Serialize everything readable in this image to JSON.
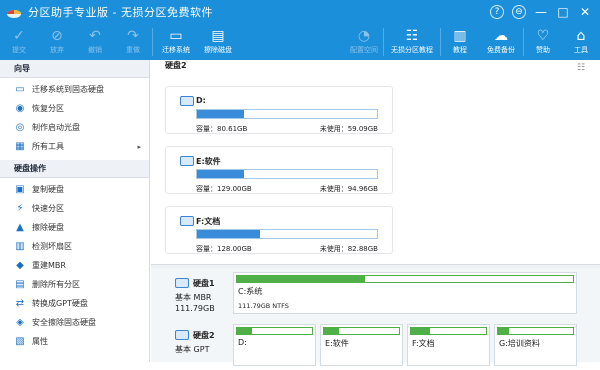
{
  "window": {
    "title": "分区助手专业版 - 无损分区免费软件",
    "controls": [
      "?",
      "⊖",
      "—",
      "□",
      "✕"
    ]
  },
  "toolbar": {
    "items": [
      {
        "name": "toolbar-submit",
        "label": "提交",
        "icon": "check-icon",
        "glyph": "✓",
        "enabled": false
      },
      {
        "name": "toolbar-discard",
        "label": "放弃",
        "icon": "discard-icon",
        "glyph": "⊘",
        "enabled": false
      },
      {
        "name": "toolbar-undo",
        "label": "撤销",
        "icon": "undo-icon",
        "glyph": "↶",
        "enabled": false
      },
      {
        "name": "toolbar-redo",
        "label": "重做",
        "icon": "redo-icon",
        "glyph": "↷",
        "enabled": false
      },
      {
        "name": "toolbar-migrate-os",
        "label": "迁移系统",
        "icon": "migrate-icon",
        "glyph": "▭",
        "enabled": true
      },
      {
        "name": "toolbar-wipe-disk",
        "label": "擦除磁盘",
        "icon": "eraser-icon",
        "glyph": "▤",
        "enabled": true
      },
      {
        "name": "toolbar-allocate-space",
        "label": "配置空间",
        "icon": "pie-icon",
        "glyph": "◔",
        "enabled": false
      },
      {
        "name": "toolbar-tutorial",
        "label": "无损分区教程",
        "icon": "tutorial-icon",
        "glyph": "☷",
        "enabled": true
      },
      {
        "name": "toolbar-tutorial-book",
        "label": "教程",
        "icon": "book-icon",
        "glyph": "▥",
        "enabled": true
      },
      {
        "name": "toolbar-free-backup",
        "label": "免费备份",
        "icon": "cloud-icon",
        "glyph": "☁",
        "enabled": true
      },
      {
        "name": "toolbar-sponsor",
        "label": "赞助",
        "icon": "heart-icon",
        "glyph": "♡",
        "enabled": true
      },
      {
        "name": "toolbar-tools",
        "label": "工具",
        "icon": "briefcase-icon",
        "glyph": "⌂",
        "enabled": true
      }
    ]
  },
  "sidebar": {
    "wizard_header": "向导",
    "wizard_items": [
      {
        "label": "迁移系统到固态硬盘",
        "icon": "migrate-icon",
        "glyph": "▭"
      },
      {
        "label": "恢复分区",
        "icon": "recover-icon",
        "glyph": "◉"
      },
      {
        "label": "制作启动光盘",
        "icon": "disc-icon",
        "glyph": "◎"
      },
      {
        "label": "所有工具",
        "icon": "tools-icon",
        "glyph": "▦",
        "arrow": "▸"
      }
    ],
    "disk_header": "硬盘操作",
    "disk_items": [
      {
        "label": "复制硬盘",
        "icon": "copy-icon",
        "glyph": "▣"
      },
      {
        "label": "快速分区",
        "icon": "lightning-icon",
        "glyph": "⚡"
      },
      {
        "label": "擦除硬盘",
        "icon": "eraser-icon",
        "glyph": "▲"
      },
      {
        "label": "检测坏扇区",
        "icon": "scan-icon",
        "glyph": "▥"
      },
      {
        "label": "重建MBR",
        "icon": "tag-icon",
        "glyph": "◆"
      },
      {
        "label": "删除所有分区",
        "icon": "delete-icon",
        "glyph": "▤"
      },
      {
        "label": "转换成GPT硬盘",
        "icon": "convert-icon",
        "glyph": "⇄"
      },
      {
        "label": "安全擦除固态硬盘",
        "icon": "ssd-erase-icon",
        "glyph": "◈"
      },
      {
        "label": "属性",
        "icon": "properties-icon",
        "glyph": "▧"
      }
    ]
  },
  "main": {
    "disk_heading": "硬盘2",
    "partitions": [
      {
        "name": "D:",
        "capacity_label": "容量：80.61GB",
        "free_label": "未使用：59.09GB",
        "used_pct": 26
      },
      {
        "name": "E:软件",
        "capacity_label": "容量：129.00GB",
        "free_label": "未使用：94.96GB",
        "used_pct": 26
      },
      {
        "name": "F:文档",
        "capacity_label": "容量：128.00GB",
        "free_label": "未使用：82.88GB",
        "used_pct": 35
      }
    ]
  },
  "diskmap": {
    "disks": [
      {
        "name": "硬盘1",
        "type": "基本 MBR",
        "size": "111.79GB",
        "parts": [
          {
            "name": "C:系统",
            "info": "111.79GB NTFS",
            "used_pct": 38
          }
        ]
      },
      {
        "name": "硬盘2",
        "type": "基本 GPT",
        "size": "",
        "parts": [
          {
            "name": "D:",
            "info": "",
            "used_pct": 20
          },
          {
            "name": "E:软件",
            "info": "",
            "used_pct": 20
          },
          {
            "name": "F:文档",
            "info": "",
            "used_pct": 25
          },
          {
            "name": "G:培训资料",
            "info": "",
            "used_pct": 15
          }
        ]
      }
    ]
  },
  "colors": {
    "accent": "#1b8fd9",
    "usage_bar": "#3b8bdb",
    "map_bar": "#4fb048"
  }
}
